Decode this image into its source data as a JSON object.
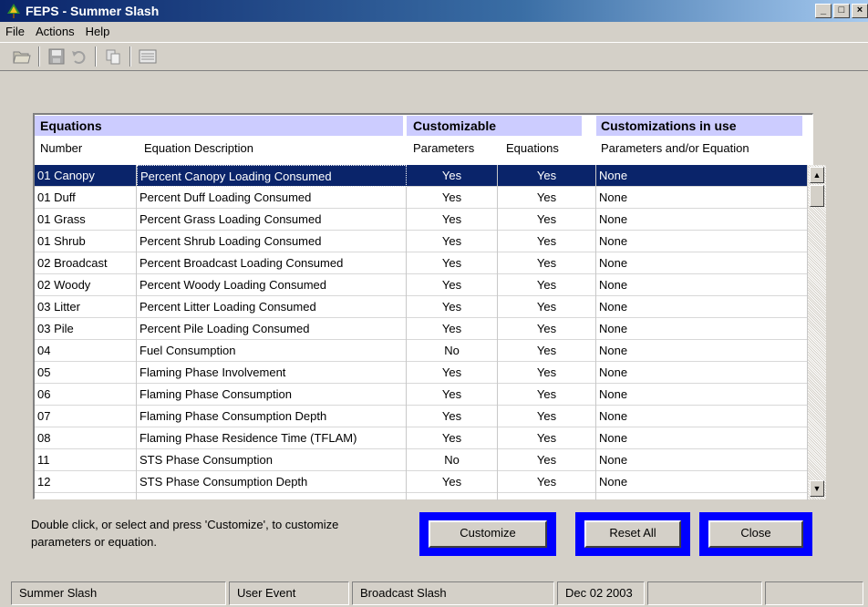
{
  "window": {
    "title": "FEPS - Summer Slash",
    "buttons": {
      "minimize": "_",
      "maximize": "□",
      "close": "×"
    }
  },
  "menu": [
    "File",
    "Actions",
    "Help"
  ],
  "toolbar": {
    "icons": [
      "open-folder-icon",
      "save-icon",
      "undo-icon",
      "copy-icon",
      "report-icon"
    ]
  },
  "table": {
    "groups": {
      "equations": "Equations",
      "customizable": "Customizable",
      "in_use": "Customizations in use"
    },
    "columns": {
      "number": "Number",
      "description": "Equation Description",
      "parameters": "Parameters",
      "equations": "Equations",
      "in_use": "Parameters and/or Equation"
    },
    "rows": [
      {
        "number": "01 Canopy",
        "description": "Percent Canopy Loading Consumed",
        "parameters": "Yes",
        "equations": "Yes",
        "in_use": "None"
      },
      {
        "number": "01 Duff",
        "description": "Percent Duff Loading Consumed",
        "parameters": "Yes",
        "equations": "Yes",
        "in_use": "None"
      },
      {
        "number": "01 Grass",
        "description": "Percent Grass Loading Consumed",
        "parameters": "Yes",
        "equations": "Yes",
        "in_use": "None"
      },
      {
        "number": "01 Shrub",
        "description": "Percent Shrub Loading Consumed",
        "parameters": "Yes",
        "equations": "Yes",
        "in_use": "None"
      },
      {
        "number": "02 Broadcast",
        "description": "Percent Broadcast Loading Consumed",
        "parameters": "Yes",
        "equations": "Yes",
        "in_use": "None"
      },
      {
        "number": "02 Woody",
        "description": "Percent Woody Loading Consumed",
        "parameters": "Yes",
        "equations": "Yes",
        "in_use": "None"
      },
      {
        "number": "03 Litter",
        "description": "Percent Litter Loading Consumed",
        "parameters": "Yes",
        "equations": "Yes",
        "in_use": "None"
      },
      {
        "number": "03 Pile",
        "description": "Percent Pile Loading Consumed",
        "parameters": "Yes",
        "equations": "Yes",
        "in_use": "None"
      },
      {
        "number": "04",
        "description": "Fuel Consumption",
        "parameters": "No",
        "equations": "Yes",
        "in_use": "None"
      },
      {
        "number": "05",
        "description": "Flaming Phase Involvement",
        "parameters": "Yes",
        "equations": "Yes",
        "in_use": "None"
      },
      {
        "number": "06",
        "description": "Flaming Phase Consumption",
        "parameters": "Yes",
        "equations": "Yes",
        "in_use": "None"
      },
      {
        "number": "07",
        "description": "Flaming Phase Consumption Depth",
        "parameters": "Yes",
        "equations": "Yes",
        "in_use": "None"
      },
      {
        "number": "08",
        "description": "Flaming Phase Residence Time (TFLAM)",
        "parameters": "Yes",
        "equations": "Yes",
        "in_use": "None"
      },
      {
        "number": "11",
        "description": "STS Phase Consumption",
        "parameters": "No",
        "equations": "Yes",
        "in_use": "None"
      },
      {
        "number": "12",
        "description": "STS Phase Consumption Depth",
        "parameters": "Yes",
        "equations": "Yes",
        "in_use": "None"
      }
    ]
  },
  "hint": "Double click, or select and press 'Customize', to customize parameters or equation.",
  "actions": {
    "customize": "Customize",
    "reset_all": "Reset All",
    "close": "Close"
  },
  "status": [
    "Summer Slash",
    "User Event",
    "Broadcast Slash",
    "Dec 02 2003",
    "",
    ""
  ],
  "colors": {
    "header_band": "#ccccff",
    "selection": "#0a246a",
    "button_highlight": "#0000ff"
  }
}
